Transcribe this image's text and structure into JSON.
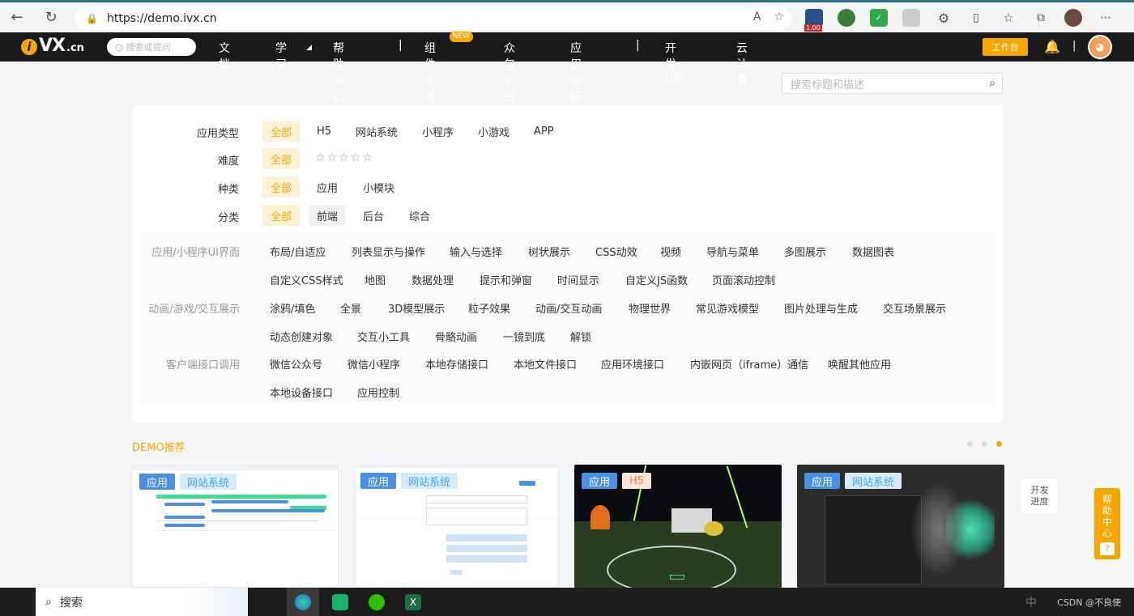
{
  "browser": {
    "url": "https://demo.ivx.cn",
    "zoom_badge": "1.00"
  },
  "header": {
    "logo_text": "VX",
    "logo_suffix": ".cn",
    "search_placeholder": "搜索或提问",
    "nav": [
      "文档",
      "学习",
      "帮助中心",
      "组件市场",
      "众包平台",
      "应用商店",
      "开发IDE",
      "云计算"
    ],
    "new_badge": "NEW",
    "workbench": "工作台"
  },
  "page_search": {
    "placeholder": "搜索标题和描述"
  },
  "filters": {
    "app_type": {
      "label": "应用类型",
      "options": [
        "全部",
        "H5",
        "网站系统",
        "小程序",
        "小游戏",
        "APP"
      ]
    },
    "difficulty": {
      "label": "难度",
      "options": [
        "全部"
      ],
      "stars": "☆☆☆☆☆"
    },
    "kind": {
      "label": "种类",
      "options": [
        "全部",
        "应用",
        "小模块"
      ]
    },
    "category": {
      "label": "分类",
      "options": [
        "全部",
        "前端",
        "后台",
        "综合"
      ]
    }
  },
  "subcategories": {
    "group1": {
      "label": "应用/小程序UI界面",
      "row1": [
        "布局/自适应",
        "列表显示与操作",
        "输入与选择",
        "树状展示",
        "CSS动效",
        "视频",
        "导航与菜单",
        "多图展示",
        "数据图表"
      ],
      "row2": [
        "自定义CSS样式",
        "地图",
        "数据处理",
        "提示和弹窗",
        "时间显示",
        "自定义JS函数",
        "页面滚动控制"
      ]
    },
    "group2": {
      "label": "动画/游戏/交互展示",
      "row1": [
        "涂鸦/填色",
        "全景",
        "3D模型展示",
        "粒子效果",
        "动画/交互动画",
        "物理世界",
        "常见游戏模型",
        "图片处理与生成",
        "交互场景展示"
      ],
      "row2": [
        "动态创建对象",
        "交互小工具",
        "骨骼动画",
        "一镜到底",
        "解锁"
      ]
    },
    "group3": {
      "label": "客户端接口调用",
      "row1": [
        "微信公众号",
        "微信小程序",
        "本地存储接口",
        "本地文件接口",
        "应用环境接口",
        "内嵌网页（iframe）通信",
        "唤醒其他应用"
      ],
      "row2": [
        "本地设备接口",
        "应用控制"
      ]
    }
  },
  "demo": {
    "title": "DEMO推荐",
    "cards": [
      {
        "badges": [
          "应用",
          "网站系统"
        ]
      },
      {
        "badges": [
          "应用",
          "网站系统"
        ]
      },
      {
        "badges": [
          "应用",
          "H5"
        ]
      },
      {
        "badges": [
          "应用",
          "网站系统"
        ]
      }
    ]
  },
  "floats": {
    "progress_line1": "开发",
    "progress_line2": "进度",
    "help": [
      "帮",
      "助",
      "中",
      "心"
    ],
    "help_q": "?"
  },
  "taskbar": {
    "search_label": "搜索",
    "ime": "中",
    "watermark": "CSDN @不良使"
  },
  "colors": {
    "accent": "#f7a700",
    "header_bg": "#1a1a1a",
    "app_badge": "#4a90e2",
    "web_badge_text": "#4aa3e3",
    "h5_badge_text": "#f08a4b"
  }
}
